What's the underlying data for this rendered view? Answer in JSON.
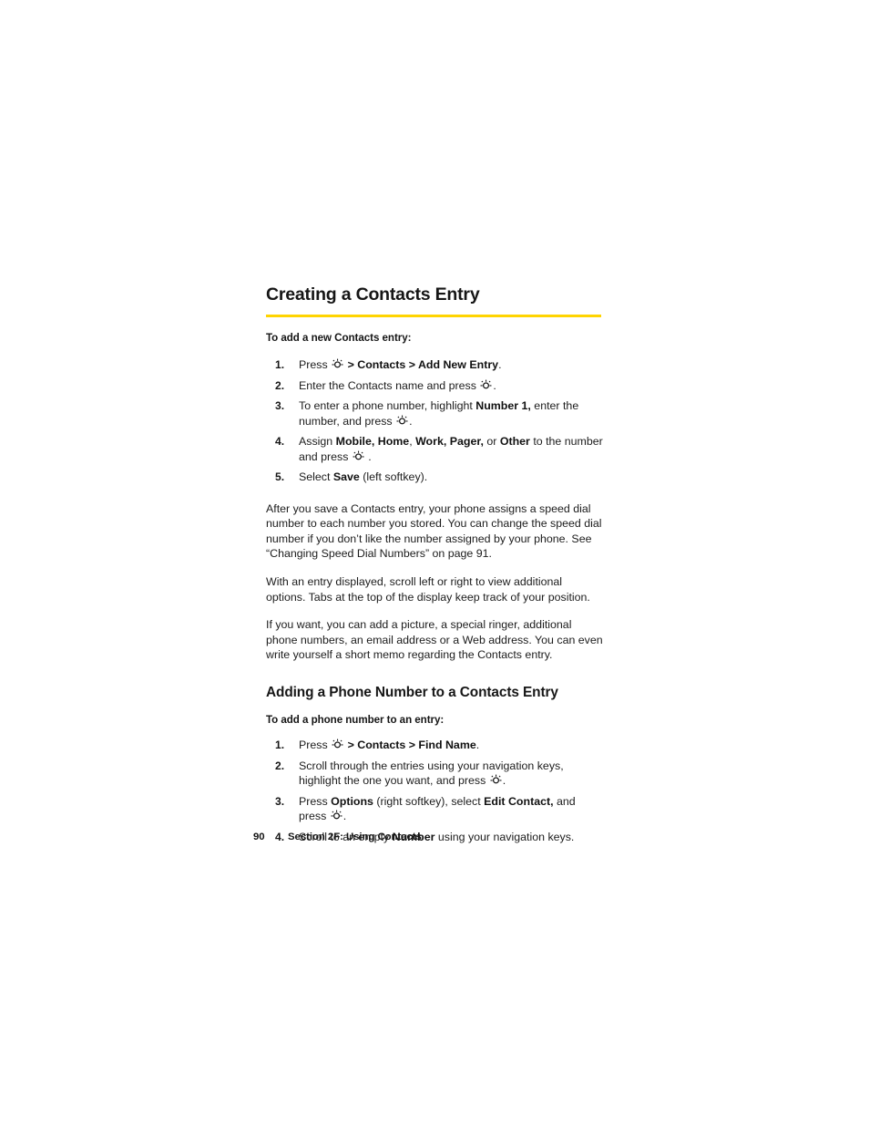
{
  "page": {
    "background": "#ffffff",
    "accent_rule_color": "#FFD400"
  },
  "heading": {
    "title": "Creating a Contacts Entry"
  },
  "section1": {
    "lead_in": "To add a new Contacts entry:",
    "steps": [
      {
        "num": "1.",
        "parts": [
          {
            "t": "Press ",
            "b": false
          },
          {
            "t": "okkey-icon",
            "icon": true
          },
          {
            "t": " > ",
            "b": true
          },
          {
            "t": "Contacts",
            "b": true
          },
          {
            "t": " > ",
            "b": true
          },
          {
            "t": "Add New Entry",
            "b": true
          },
          {
            "t": ".",
            "b": false
          }
        ],
        "plain": "Press [OK key] > Contacts > Add New Entry."
      },
      {
        "num": "2.",
        "parts": [
          {
            "t": "Enter the Contacts name and press ",
            "b": false
          },
          {
            "t": "okkey-icon",
            "icon": true
          },
          {
            "t": ".",
            "b": false
          }
        ],
        "plain": "Enter the Contacts name and press [OK key]."
      },
      {
        "num": "3.",
        "parts": [
          {
            "t": "To enter a phone number, highlight ",
            "b": false
          },
          {
            "t": "Number 1,",
            "b": true
          },
          {
            "t": " enter the number, and press ",
            "b": false
          },
          {
            "t": "okkey-icon",
            "icon": true
          },
          {
            "t": ".",
            "b": false
          }
        ],
        "plain": "To enter a phone number, highlight Number 1, enter the number, and press [OK key]."
      },
      {
        "num": "4.",
        "parts": [
          {
            "t": "Assign ",
            "b": false
          },
          {
            "t": "Mobile, Home",
            "b": true
          },
          {
            "t": ", ",
            "b": false
          },
          {
            "t": "Work, Pager,",
            "b": true
          },
          {
            "t": " or ",
            "b": false
          },
          {
            "t": "Other",
            "b": true
          },
          {
            "t": " to the number and press ",
            "b": false
          },
          {
            "t": "okkey-icon",
            "icon": true
          },
          {
            "t": " .",
            "b": false
          }
        ],
        "plain": "Assign Mobile, Home, Work, Pager, or Other to the number and press [OK key]."
      },
      {
        "num": "5.",
        "parts": [
          {
            "t": "Select ",
            "b": false
          },
          {
            "t": "Save",
            "b": true
          },
          {
            "t": " (left softkey).",
            "b": false
          }
        ],
        "plain": "Select Save (left softkey)."
      }
    ],
    "paragraphs": [
      "After you save a Contacts entry, your phone assigns a speed dial number to each number you stored. You can change the speed dial number if you don’t like the number assigned by your phone. See “Changing Speed Dial Numbers” on page 91.",
      "With an entry displayed, scroll left or right to view additional options. Tabs at the top of the display keep track of your position.",
      "If you want, you can add a picture, a special ringer, additional phone numbers, an email address or a Web address. You can even write yourself a short memo regarding the Contacts entry."
    ]
  },
  "section2": {
    "sub_title": "Adding a Phone Number to a Contacts Entry",
    "lead_in": "To add a phone number to an entry:",
    "steps": [
      {
        "num": "1.",
        "parts": [
          {
            "t": "Press ",
            "b": false
          },
          {
            "t": "okkey-icon",
            "icon": true
          },
          {
            "t": " > ",
            "b": true
          },
          {
            "t": "Contacts",
            "b": true
          },
          {
            "t": " > ",
            "b": true
          },
          {
            "t": "Find Name",
            "b": true
          },
          {
            "t": ".",
            "b": false
          }
        ],
        "plain": "Press [OK key] > Contacts > Find Name."
      },
      {
        "num": "2.",
        "parts": [
          {
            "t": "Scroll through the entries using your navigation keys, highlight the one you want, and press ",
            "b": false
          },
          {
            "t": "okkey-icon",
            "icon": true
          },
          {
            "t": ".",
            "b": false
          }
        ],
        "plain": "Scroll through the entries using your navigation keys, highlight the one you want, and press [OK key]."
      },
      {
        "num": "3.",
        "parts": [
          {
            "t": "Press ",
            "b": false
          },
          {
            "t": "Options",
            "b": true
          },
          {
            "t": " (right softkey), select ",
            "b": false
          },
          {
            "t": "Edit Contact,",
            "b": true
          },
          {
            "t": " and press ",
            "b": false
          },
          {
            "t": "okkey-icon",
            "icon": true
          },
          {
            "t": ".",
            "b": false
          }
        ],
        "plain": "Press Options (right softkey), select Edit Contact, and press [OK key]."
      },
      {
        "num": "4.",
        "parts": [
          {
            "t": "Scroll to an empty ",
            "b": false
          },
          {
            "t": "Number",
            "b": true
          },
          {
            "t": " using your navigation keys.",
            "b": false
          }
        ],
        "plain": "Scroll to an empty Number using your navigation keys."
      }
    ]
  },
  "footer": {
    "page_number": "90",
    "section_label": "Section 2F: Using Contacts"
  }
}
